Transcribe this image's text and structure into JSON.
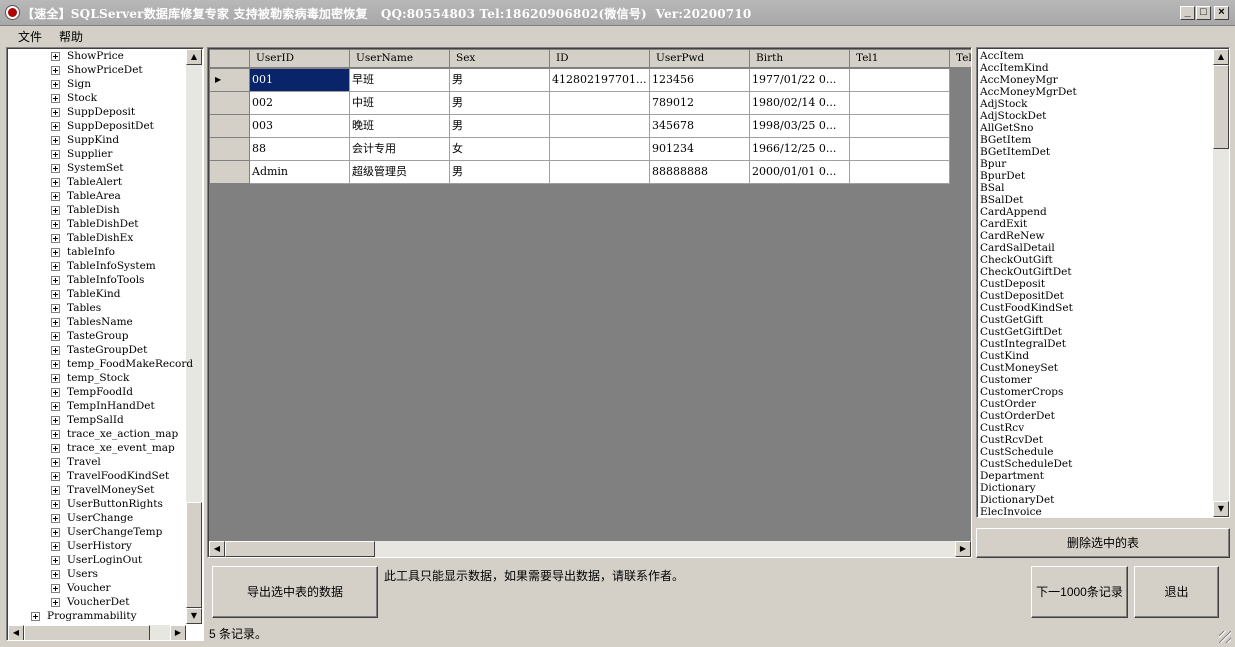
{
  "window": {
    "title": "【速全】SQLServer数据库修复专家 支持被勒索病毒加密恢复   QQ:80554803 Tel:18620906802(微信号)  Ver:20200710",
    "minimize": "_",
    "maximize": "□",
    "close": "×"
  },
  "menu": [
    "文件",
    "帮助"
  ],
  "tree": {
    "items": [
      "ShowPrice",
      "ShowPriceDet",
      "Sign",
      "Stock",
      "SuppDeposit",
      "SuppDepositDet",
      "SuppKind",
      "Supplier",
      "SystemSet",
      "TableAlert",
      "TableArea",
      "TableDish",
      "TableDishDet",
      "TableDishEx",
      "tableInfo",
      "TableInfoSystem",
      "TableInfoTools",
      "TableKind",
      "Tables",
      "TablesName",
      "TasteGroup",
      "TasteGroupDet",
      "temp_FoodMakeRecord",
      "temp_Stock",
      "TempFoodId",
      "TempInHandDet",
      "TempSalId",
      "trace_xe_action_map",
      "trace_xe_event_map",
      "Travel",
      "TravelFoodKindSet",
      "TravelMoneySet",
      "UserButtonRights",
      "UserChange",
      "UserChangeTemp",
      "UserHistory",
      "UserLoginOut",
      "Users",
      "Voucher",
      "VoucherDet"
    ],
    "root_item": "Programmability"
  },
  "grid": {
    "columns": [
      "UserID",
      "UserName",
      "Sex",
      "ID",
      "UserPwd",
      "Birth",
      "Tel1",
      "Tel"
    ],
    "rows": [
      [
        "001",
        "早班",
        "男",
        "412802197701...",
        "123456",
        "1977/01/22 0...",
        ""
      ],
      [
        "002",
        "中班",
        "男",
        "",
        "789012",
        "1980/02/14 0...",
        ""
      ],
      [
        "003",
        "晚班",
        "男",
        "",
        "345678",
        "1998/03/25 0...",
        ""
      ],
      [
        "88",
        "会计专用",
        "女",
        "",
        "901234",
        "1966/12/25 0...",
        ""
      ],
      [
        "Admin",
        "超级管理员",
        "男",
        "",
        "88888888",
        "2000/01/01 0...",
        ""
      ]
    ],
    "row_indicator": "▶"
  },
  "tables_list": [
    "AccItem",
    "AccItemKind",
    "AccMoneyMgr",
    "AccMoneyMgrDet",
    "AdjStock",
    "AdjStockDet",
    "AllGetSno",
    "BGetItem",
    "BGetItemDet",
    "Bpur",
    "BpurDet",
    "BSal",
    "BSalDet",
    "CardAppend",
    "CardExit",
    "CardReNew",
    "CardSalDetail",
    "CheckOutGift",
    "CheckOutGiftDet",
    "CustDeposit",
    "CustDepositDet",
    "CustFoodKindSet",
    "CustGetGift",
    "CustGetGiftDet",
    "CustIntegralDet",
    "CustKind",
    "CustMoneySet",
    "Customer",
    "CustomerCrops",
    "CustOrder",
    "CustOrderDet",
    "CustRcv",
    "CustRcvDet",
    "CustSchedule",
    "CustScheduleDet",
    "Department",
    "Dictionary",
    "DictionaryDet",
    "ElecInvoice"
  ],
  "buttons": {
    "delete_table": "删除选中的表",
    "export": "导出选中表的数据",
    "next_page": "下一1000条记录",
    "exit": "退出"
  },
  "note": "此工具只能显示数据，如果需要导出数据，请联系作者。",
  "status": "5 条记录。"
}
